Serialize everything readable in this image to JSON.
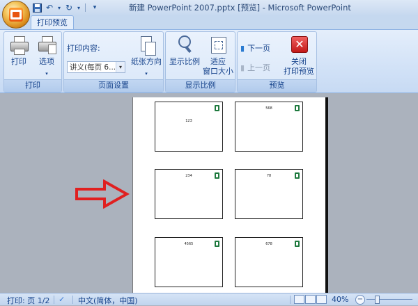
{
  "window": {
    "title": "新建 PowerPoint 2007.pptx [预览] - Microsoft PowerPoint"
  },
  "tabs": {
    "active": "打印预览"
  },
  "ribbon": {
    "print": {
      "print_label": "打印",
      "options_label": "选项",
      "group_label": "打印"
    },
    "page_setup": {
      "content_label": "打印内容:",
      "content_value": "讲义(每页 6...",
      "orientation_label": "纸张方向",
      "group_label": "页面设置"
    },
    "zoom": {
      "zoom_label": "显示比例",
      "fit_label_1": "适应",
      "fit_label_2": "窗口大小",
      "group_label": "显示比例"
    },
    "preview": {
      "next_label": "下一页",
      "prev_label": "上一页",
      "close_label_1": "关闭",
      "close_label_2": "打印预览",
      "group_label": "预览"
    }
  },
  "page": {
    "slides": [
      "123",
      "568",
      "234",
      "78",
      "4565",
      "678"
    ]
  },
  "status": {
    "page": "打印: 页 1/2",
    "language": "中文(简体，中国)",
    "zoom": "40%"
  },
  "colors": {
    "accent": "#15428b",
    "arrow": "#e02020",
    "logo": "#1f7a3f"
  }
}
